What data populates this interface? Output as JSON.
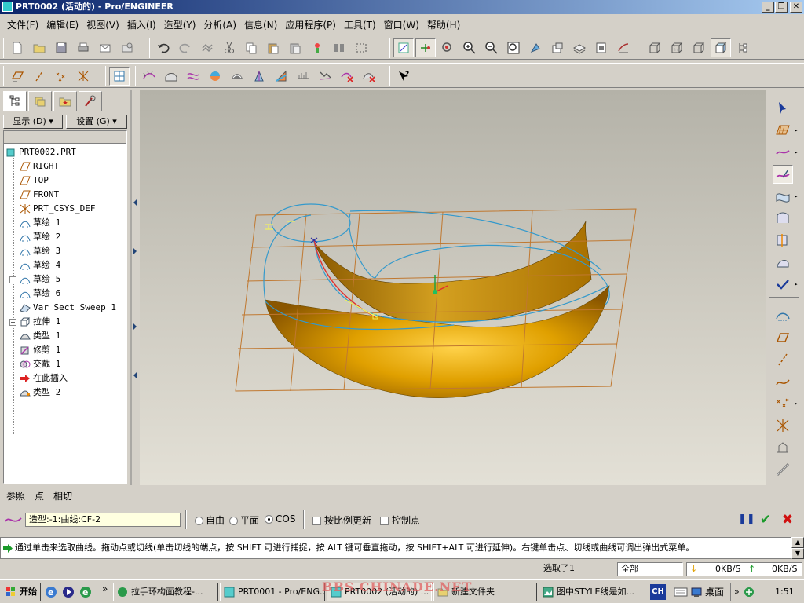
{
  "window": {
    "title": "PRT0002 (活动的) - Pro/ENGINEER",
    "min_label": "_",
    "max_label": "❐",
    "close_label": "✕"
  },
  "menu": [
    "文件(F)",
    "编辑(E)",
    "视图(V)",
    "插入(I)",
    "造型(Y)",
    "分析(A)",
    "信息(N)",
    "应用程序(P)",
    "工具(T)",
    "窗口(W)",
    "帮助(H)"
  ],
  "left_panel": {
    "display_btn": "显示 (D) ▾",
    "settings_btn": "设置 (G) ▾",
    "tree": [
      {
        "label": "PRT0002.PRT",
        "icon": "part-icon"
      },
      {
        "label": "RIGHT",
        "icon": "datum-plane-icon"
      },
      {
        "label": "TOP",
        "icon": "datum-plane-icon"
      },
      {
        "label": "FRONT",
        "icon": "datum-plane-icon"
      },
      {
        "label": "PRT_CSYS_DEF",
        "icon": "csys-icon"
      },
      {
        "label": "草绘 1",
        "icon": "sketch-icon"
      },
      {
        "label": "草绘 2",
        "icon": "sketch-icon"
      },
      {
        "label": "草绘 3",
        "icon": "sketch-icon"
      },
      {
        "label": "草绘 4",
        "icon": "sketch-icon"
      },
      {
        "label": "草绘 5",
        "icon": "sketch-icon"
      },
      {
        "label": "草绘 6",
        "icon": "sketch-icon"
      },
      {
        "label": "Var Sect Sweep 1",
        "icon": "sweep-icon"
      },
      {
        "label": "拉伸 1",
        "icon": "extrude-icon"
      },
      {
        "label": "类型 1",
        "icon": "style-icon"
      },
      {
        "label": "修剪 1",
        "icon": "trim-icon"
      },
      {
        "label": "交截 1",
        "icon": "intersect-icon"
      },
      {
        "label": "在此插入",
        "icon": "insert-here-icon"
      },
      {
        "label": "类型 2",
        "icon": "style-icon"
      }
    ]
  },
  "dashboard": {
    "tabs": [
      "参照",
      "点",
      "相切"
    ],
    "type_field": "造型:-1:曲线:CF-2",
    "radio_free": "自由",
    "radio_plane": "平面",
    "radio_cos": "COS",
    "chk_scale": "按比例更新",
    "chk_ctrl": "控制点",
    "pause_label": "❚❚",
    "ok_label": "✔",
    "cancel_label": "✖"
  },
  "message": "通过单击来选取曲线。拖动点或切线(单击切线的端点，按 SHIFT 可进行捕捉，按 ALT 键可垂直拖动，按 SHIFT+ALT 可进行延伸)。右键单击点、切线或曲线可调出弹出式菜单。",
  "status": {
    "selected": "选取了1",
    "filter": "全部",
    "down_rate": "0KB/S",
    "up_rate": "0KB/S"
  },
  "taskbar": {
    "start": "开始",
    "more_label": "»",
    "tasks": [
      "拉手环构面教程-...",
      "PRT0001 - Pro/ENG...",
      "PRT0002 (活动的) ...",
      "新建文件夹",
      "图中STYLE线是如..."
    ],
    "lang": "CH",
    "desktop": "桌面",
    "clock": "1:51"
  },
  "watermark": "BBS.CHINADE.NET",
  "colors": {
    "surface_gold": "#e0a000",
    "curve_blue": "#3399cc",
    "grid_brown": "#c07830"
  }
}
